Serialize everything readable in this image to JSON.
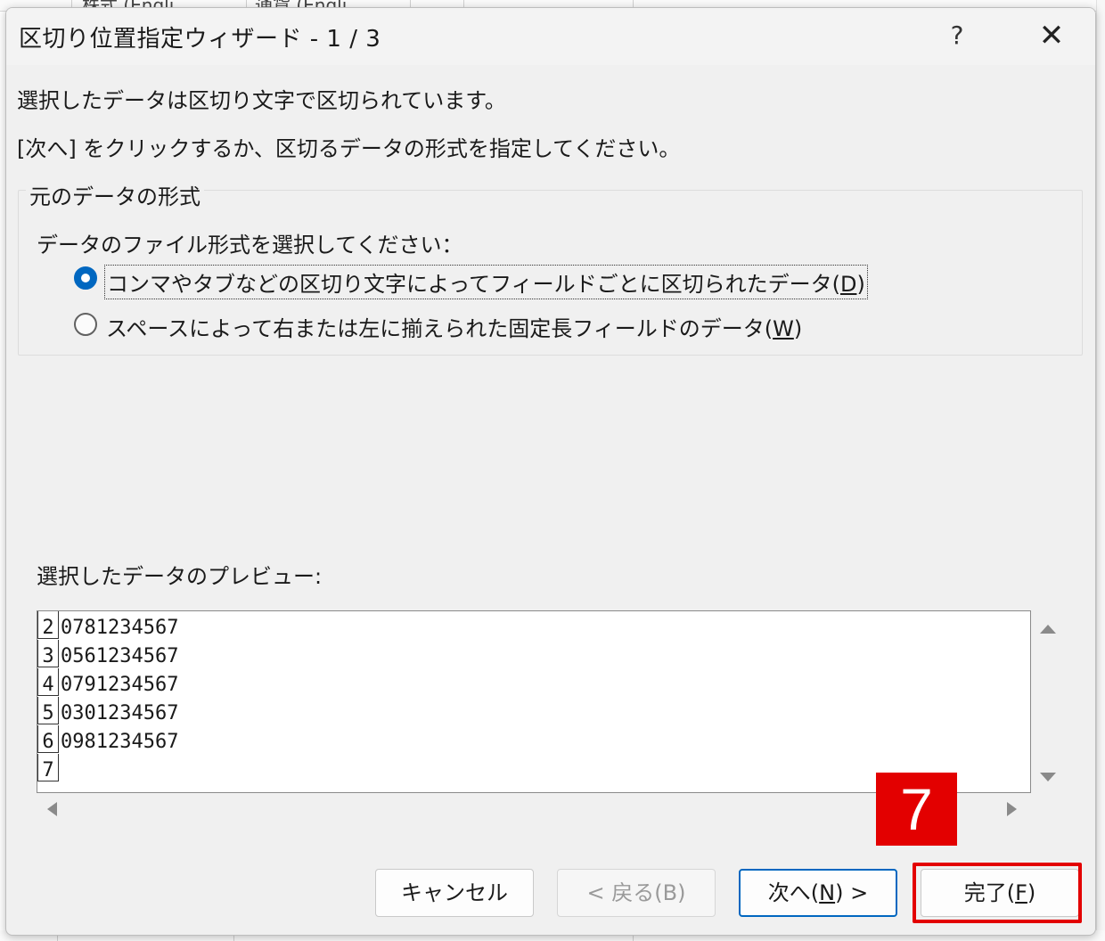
{
  "background": {
    "sheet_headers": [
      "株式 (Engli…",
      "通貨 (Engli…"
    ]
  },
  "dialog": {
    "title": "区切り位置指定ウィザード - 1 / 3",
    "help_label": "?",
    "close_label": "✕",
    "message1": "選択したデータは区切り文字で区切られています。",
    "message2": "[次へ] をクリックするか、区切るデータの形式を指定してください。",
    "group_title": "元のデータの形式",
    "prompt": "データのファイル形式を選択してください：",
    "options": [
      {
        "label": "コンマやタブなどの区切り文字によってフィールドごとに区切られたデータ(",
        "accel": "D",
        "suffix": ")",
        "selected": true
      },
      {
        "label": "スペースによって右または左に揃えられた固定長フィールドのデータ(",
        "accel": "W",
        "suffix": ")",
        "selected": false
      }
    ],
    "preview_label": "選択したデータのプレビュー:",
    "preview_rows": [
      {
        "num": "2",
        "value": "0781234567"
      },
      {
        "num": "3",
        "value": "0561234567"
      },
      {
        "num": "4",
        "value": "0791234567"
      },
      {
        "num": "5",
        "value": "0301234567"
      },
      {
        "num": "6",
        "value": "0981234567"
      },
      {
        "num": "7",
        "value": ""
      }
    ],
    "buttons": {
      "cancel": "キャンセル",
      "back": "< 戻る(B)",
      "next_prefix": "次へ(",
      "next_accel": "N",
      "next_suffix": ") >",
      "finish_prefix": "完了(",
      "finish_accel": "F",
      "finish_suffix": ")"
    }
  },
  "annotation": {
    "step_number": "7",
    "color": "#e30000"
  },
  "colors": {
    "accent": "#0067c0",
    "dialog_bg": "#f0f0f0"
  }
}
